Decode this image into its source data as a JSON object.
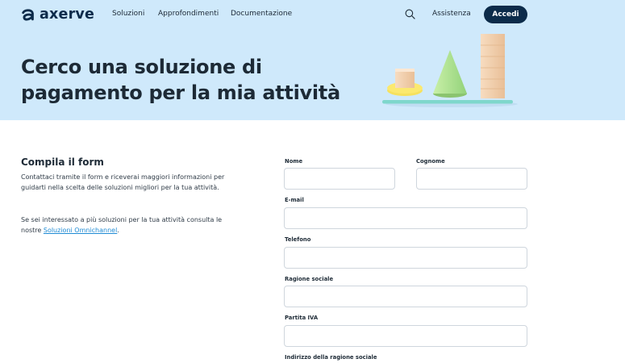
{
  "brand": {
    "name": "axerve",
    "color": "#0c2b4a"
  },
  "nav": {
    "items": [
      "Soluzioni",
      "Approfondimenti",
      "Documentazione"
    ],
    "assistenza": "Assistenza",
    "login": "Accedi",
    "search_icon": "search-icon"
  },
  "hero": {
    "title": "Cerco una soluzione di pagamento per la mia attività",
    "background": "#cfe9fb"
  },
  "intro": {
    "heading": "Compila il form",
    "paragraph1": "Contattaci tramite il form e riceverai maggiori informazioni per guidarti nella scelta delle soluzioni migliori per la tua attività.",
    "paragraph2_prefix": "Se sei interessato a più soluzioni per la tua attività consulta le nostre ",
    "link": "Soluzioni Omnichannel",
    "paragraph2_suffix": "."
  },
  "form": {
    "nome": {
      "label": "Nome",
      "value": "",
      "placeholder": ""
    },
    "cognome": {
      "label": "Cognome",
      "value": "",
      "placeholder": ""
    },
    "email": {
      "label": "E-mail",
      "value": "",
      "placeholder": ""
    },
    "telefono": {
      "label": "Telefono",
      "value": "",
      "placeholder": ""
    },
    "ragione_sociale": {
      "label": "Ragione sociale",
      "value": "",
      "placeholder": ""
    },
    "partita_iva": {
      "label": "Partita IVA",
      "value": "",
      "placeholder": ""
    },
    "indirizzo": {
      "label": "Indirizzo della ragione sociale"
    }
  }
}
